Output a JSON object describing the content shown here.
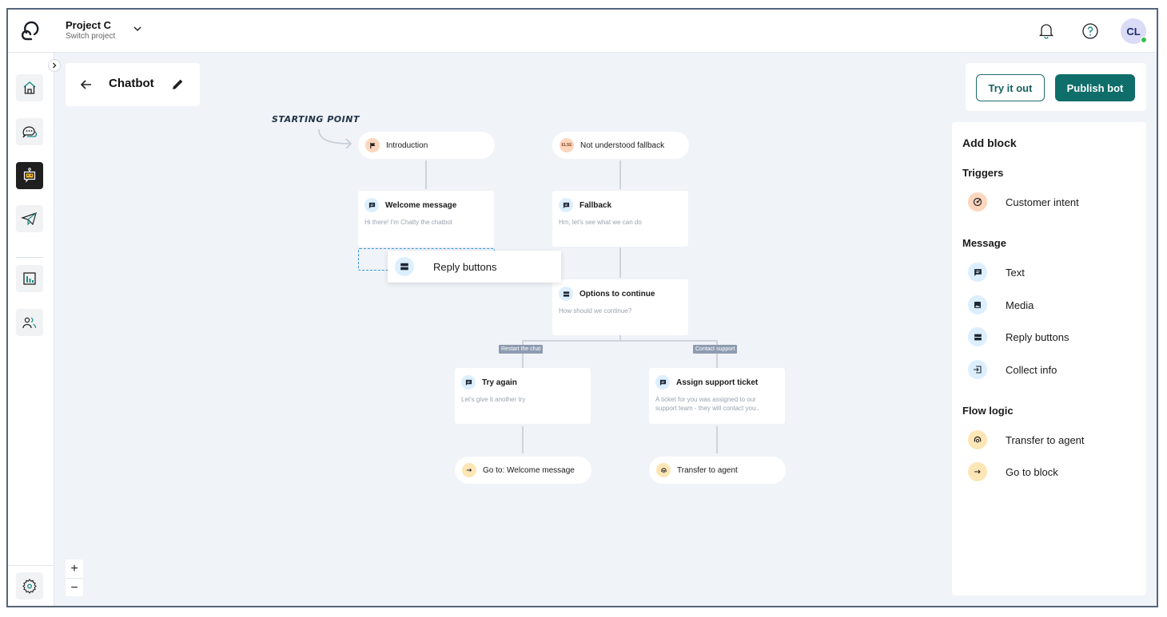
{
  "header": {
    "project_name": "Project C",
    "project_sub": "Switch project",
    "avatar_initials": "CL",
    "avatar_status": "online"
  },
  "sidebar": {
    "items": [
      {
        "name": "home",
        "icon": "home-icon"
      },
      {
        "name": "conversations",
        "icon": "chat-bubble-icon"
      },
      {
        "name": "chatbot",
        "icon": "bot-icon",
        "active": true
      },
      {
        "name": "campaigns",
        "icon": "paper-plane-icon"
      },
      {
        "name": "reports",
        "icon": "bar-chart-icon"
      },
      {
        "name": "contacts",
        "icon": "users-icon"
      }
    ],
    "settings_icon": "gear-icon"
  },
  "title_bar": {
    "title": "Chatbot"
  },
  "actions": {
    "try_label": "Try it out",
    "publish_label": "Publish bot"
  },
  "panel": {
    "title": "Add block",
    "sections": [
      {
        "title": "Triggers",
        "items": [
          {
            "label": "Customer intent",
            "icon": "target-icon"
          }
        ]
      },
      {
        "title": "Message",
        "items": [
          {
            "label": "Text",
            "icon": "message-icon"
          },
          {
            "label": "Media",
            "icon": "image-icon"
          },
          {
            "label": "Reply buttons",
            "icon": "reply-buttons-icon"
          },
          {
            "label": "Collect info",
            "icon": "input-icon"
          }
        ]
      },
      {
        "title": "Flow logic",
        "items": [
          {
            "label": "Transfer to agent",
            "icon": "headset-icon"
          },
          {
            "label": "Go to block",
            "icon": "arrow-right-icon"
          }
        ]
      }
    ]
  },
  "canvas": {
    "starting_label": "STARTING POINT",
    "nodes": {
      "introduction": {
        "title": "Introduction"
      },
      "fallback_trigger": {
        "title": "Not understood fallback",
        "badge": "ELSE"
      },
      "welcome": {
        "title": "Welcome message",
        "body": "Hi there! I'm Chatty the chatbot"
      },
      "fallback": {
        "title": "Fallback",
        "body": "Hm, let's see what we can do"
      },
      "options": {
        "title": "Options to continue",
        "body": "How should we continue?"
      },
      "try_again": {
        "title": "Try again",
        "body": "Let's give it another try"
      },
      "assign": {
        "title": "Assign support ticket",
        "body": "A ticket for you was assigned to our support team - they will contact you.."
      },
      "goto": {
        "title": "Go to: Welcome message"
      },
      "transfer": {
        "title": "Transfer to agent"
      }
    },
    "branches": {
      "left": "Restart the chat",
      "right": "Contact support"
    },
    "dragging": {
      "label": "Reply buttons"
    },
    "zoom_in": "+",
    "zoom_out": "−"
  }
}
